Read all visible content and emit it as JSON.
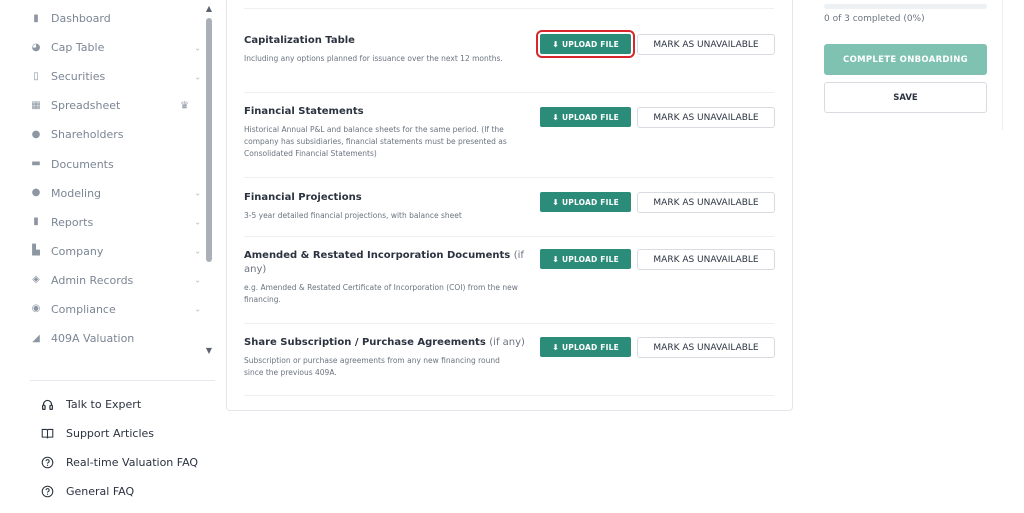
{
  "sidebar": {
    "items": [
      {
        "label": "Dashboard",
        "icon": "dashboard-icon",
        "chevron": false
      },
      {
        "label": "Cap Table",
        "icon": "pie-chart-icon",
        "chevron": true
      },
      {
        "label": "Securities",
        "icon": "document-icon",
        "chevron": true
      },
      {
        "label": "Spreadsheet",
        "icon": "spreadsheet-icon",
        "chevron": false,
        "crown": true
      },
      {
        "label": "Shareholders",
        "icon": "person-icon",
        "chevron": false
      },
      {
        "label": "Documents",
        "icon": "folder-icon",
        "chevron": false
      },
      {
        "label": "Modeling",
        "icon": "lightbulb-icon",
        "chevron": true
      },
      {
        "label": "Reports",
        "icon": "report-icon",
        "chevron": true
      },
      {
        "label": "Company",
        "icon": "building-icon",
        "chevron": true
      },
      {
        "label": "Admin Records",
        "icon": "records-icon",
        "chevron": true
      },
      {
        "label": "Compliance",
        "icon": "shield-icon",
        "chevron": true
      },
      {
        "label": "409A Valuation",
        "icon": "valuation-icon",
        "chevron": false
      }
    ],
    "help": [
      {
        "label": "Talk to Expert",
        "icon": "headset-icon"
      },
      {
        "label": "Support Articles",
        "icon": "book-icon"
      },
      {
        "label": "Real-time Valuation FAQ",
        "icon": "question-icon"
      },
      {
        "label": "General FAQ",
        "icon": "question-icon"
      }
    ]
  },
  "documents": [
    {
      "title": "Capitalization Table",
      "optional": "",
      "desc": "Including any options planned for issuance over the next 12 months."
    },
    {
      "title": "Financial Statements",
      "optional": "",
      "desc": "Historical Annual P&L and balance sheets for the same period. (If the company has subsidiaries, financial statements must be presented as Consolidated Financial Statements)"
    },
    {
      "title": "Financial Projections",
      "optional": "",
      "desc": "3-5 year detailed financial projections, with balance sheet"
    },
    {
      "title": "Amended & Restated Incorporation Documents",
      "optional": "(if any)",
      "desc": "e.g. Amended & Restated Certificate of Incorporation (COI) from the new financing."
    },
    {
      "title": "Share Subscription / Purchase Agreements",
      "optional": "(if any)",
      "desc": "Subscription or purchase agreements from any new financing round since the previous 409A."
    }
  ],
  "buttons": {
    "upload_label": "UPLOAD FILE",
    "unavailable_label": "MARK AS UNAVAILABLE"
  },
  "right_panel": {
    "progress_text": "0 of 3 completed (0%)",
    "progress_fraction": 0,
    "complete_label": "COMPLETE ONBOARDING",
    "save_label": "SAVE"
  },
  "colors": {
    "accent": "#2a8c79",
    "accent_disabled": "#7fc2b2",
    "highlight": "#d9262c"
  }
}
